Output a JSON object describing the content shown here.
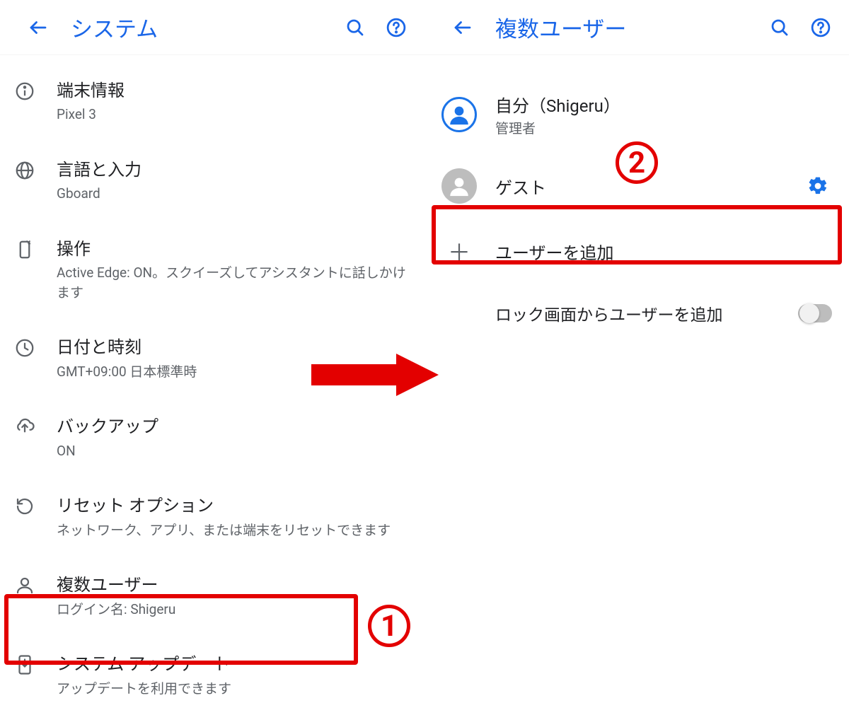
{
  "left": {
    "title": "システム",
    "items": [
      {
        "title": "端末情報",
        "sub": "Pixel 3"
      },
      {
        "title": "言語と入力",
        "sub": "Gboard"
      },
      {
        "title": "操作",
        "sub": "Active Edge: ON。スクイーズしてアシスタントに話しかけます"
      },
      {
        "title": "日付と時刻",
        "sub": "GMT+09:00 日本標準時"
      },
      {
        "title": "バックアップ",
        "sub": "ON"
      },
      {
        "title": "リセット オプション",
        "sub": "ネットワーク、アプリ、または端末をリセットできます"
      },
      {
        "title": "複数ユーザー",
        "sub": "ログイン名: Shigeru"
      },
      {
        "title": "システム アップデート",
        "sub": "アップデートを利用できます"
      }
    ]
  },
  "right": {
    "title": "複数ユーザー",
    "self": {
      "title": "自分（Shigeru）",
      "sub": "管理者"
    },
    "guest": {
      "title": "ゲスト"
    },
    "add_user": "ユーザーを追加",
    "lock_add": "ロック画面からユーザーを追加"
  },
  "annotations": {
    "step1": "1",
    "step2": "2"
  }
}
